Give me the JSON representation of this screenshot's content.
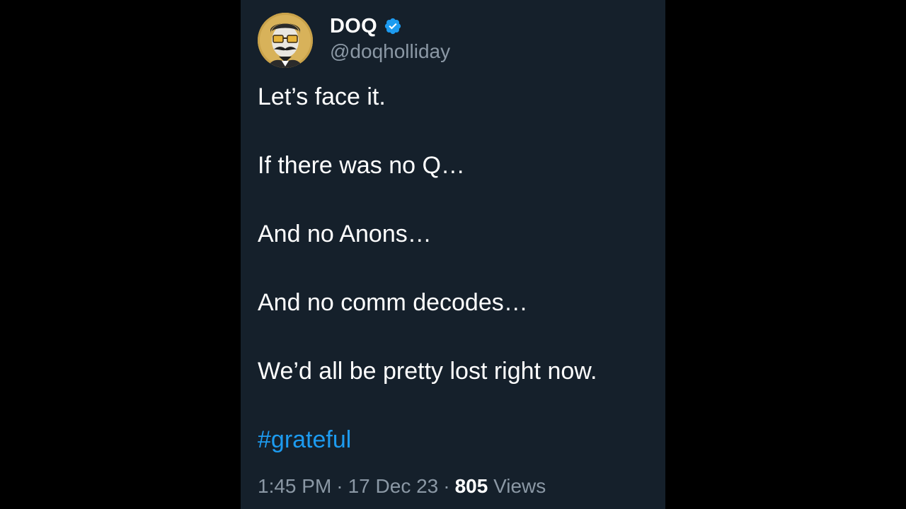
{
  "colors": {
    "page_background": "#000000",
    "card_background": "#15202b",
    "text_primary": "#ffffff",
    "text_secondary": "#8b98a5",
    "accent_link": "#1d9bf0",
    "verified_badge": "#1d9bf0"
  },
  "tweet": {
    "author": {
      "display_name": "DOQ",
      "handle": "@doqholliday",
      "verified": true,
      "verified_icon": "verified-badge-icon",
      "avatar_icon": "mustached-man-with-sunglasses-avatar"
    },
    "lines": [
      "Let’s face it.",
      "If there was no Q…",
      "And no Anons…",
      "And no comm decodes…",
      "We’d all be pretty lost right now."
    ],
    "hashtag": "#grateful",
    "time": "1:45 PM",
    "separator": "·",
    "date": "17 Dec 23",
    "views_count": "805",
    "views_label": "Views"
  }
}
